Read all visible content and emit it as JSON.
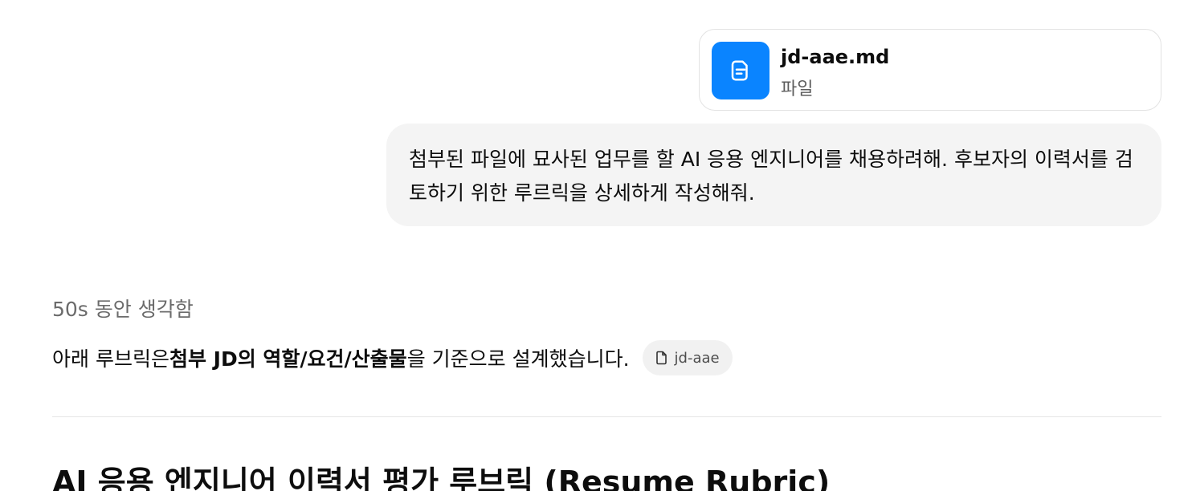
{
  "attachment": {
    "file_name": "jd-aae.md",
    "file_type": "파일",
    "icon": "document-icon",
    "icon_bg_color": "#0a84ff"
  },
  "user_message": {
    "text": "첨부된 파일에 묘사된 업무를 할 AI 응용 엔지니어를 채용하려해. 후보자의 이력서를 검토하기 위한 루르릭을 상세하게 작성해줘."
  },
  "assistant": {
    "thinking_label": "50s 동안 생각함",
    "intro": {
      "before": "아래 루브릭은 ",
      "bold": "첨부 JD의 역할/요건/산출물",
      "after": "을 기준으로 설계했습니다."
    },
    "citation": {
      "label": "jd-aae",
      "icon": "file-icon"
    },
    "heading": "AI 응용 엔지니어 이력서 평가 루브릭 (Resume Rubric)"
  }
}
